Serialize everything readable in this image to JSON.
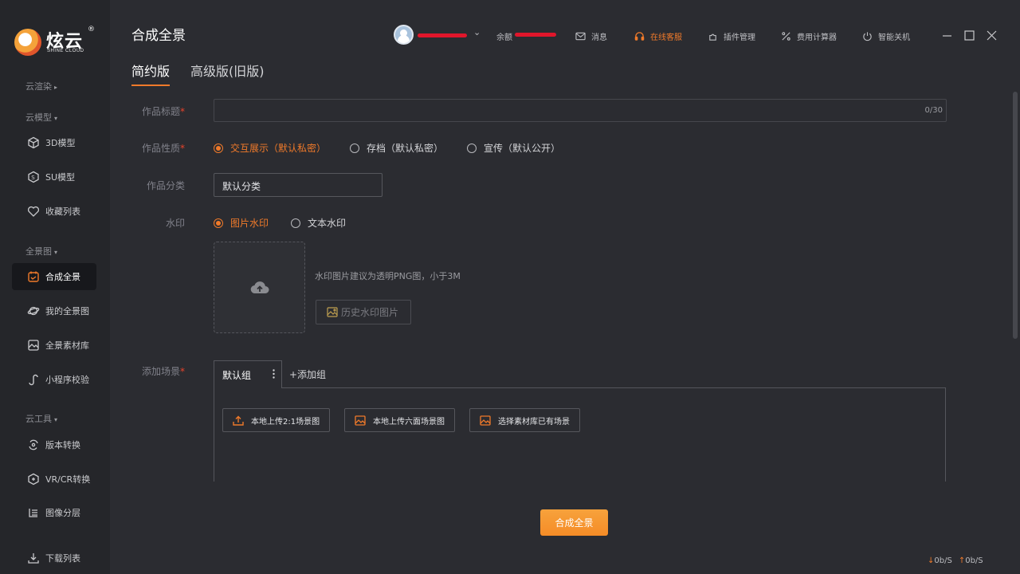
{
  "brand": {
    "name": "炫云",
    "sub": "SHINE CLOUD",
    "reg": "®"
  },
  "sidebar": {
    "groups": [
      {
        "label": "云渲染",
        "caret": "▸"
      },
      {
        "label": "云模型",
        "caret": "▾"
      },
      {
        "label": "全景图",
        "caret": "▾"
      },
      {
        "label": "云工具",
        "caret": "▾"
      }
    ],
    "items": [
      {
        "label": "3D模型"
      },
      {
        "label": "SU模型"
      },
      {
        "label": "收藏列表"
      },
      {
        "label": "合成全景"
      },
      {
        "label": "我的全景图"
      },
      {
        "label": "全景素材库"
      },
      {
        "label": "小程序校验"
      },
      {
        "label": "版本转换"
      },
      {
        "label": "VR/CR转换"
      },
      {
        "label": "图像分层"
      },
      {
        "label": "下载列表"
      }
    ]
  },
  "header": {
    "title": "合成全景",
    "tabs": [
      {
        "label": "简约版"
      },
      {
        "label": "高级版(旧版)"
      }
    ],
    "balance_label": "余额",
    "dropdown_caret": "⌄",
    "items": [
      {
        "label": "消息"
      },
      {
        "label": "在线客服"
      },
      {
        "label": "插件管理"
      },
      {
        "label": "费用计算器"
      },
      {
        "label": "智能关机"
      }
    ]
  },
  "form": {
    "title_label": "作品标题",
    "title_value": "",
    "title_counter": "0/30",
    "nature_label": "作品性质",
    "nature_options": [
      {
        "label": "交互展示（默认私密）"
      },
      {
        "label": "存档（默认私密）"
      },
      {
        "label": "宣传（默认公开）"
      }
    ],
    "category_label": "作品分类",
    "category_value": "默认分类",
    "watermark_label": "水印",
    "watermark_options": [
      {
        "label": "图片水印"
      },
      {
        "label": "文本水印"
      }
    ],
    "watermark_hint": "水印图片建议为透明PNG图，小于3M",
    "history_button": "历史水印图片",
    "scene_label": "添加场景",
    "required_mark": "*",
    "group_tab": "默认组",
    "add_group": "+添加组",
    "scene_buttons": [
      {
        "label": "本地上传2:1场景图"
      },
      {
        "label": "本地上传六面场景图"
      },
      {
        "label": "选择素材库已有场景"
      }
    ],
    "submit_button": "合成全景"
  },
  "status": {
    "down": "0b/S",
    "up": "0b/S"
  },
  "colors": {
    "accent": "#f07a2a",
    "primary_button": "#f5922d",
    "background": "#2b2c31",
    "sidebar": "#25262a"
  }
}
